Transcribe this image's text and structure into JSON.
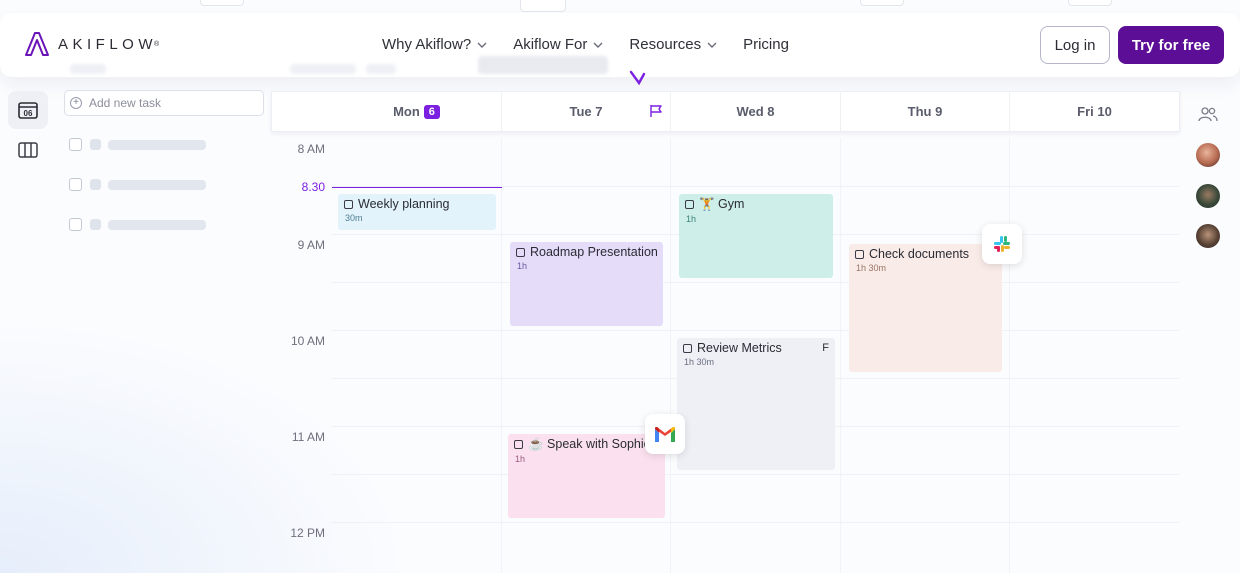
{
  "brand": {
    "name": "AKIFLOW",
    "reg": "®",
    "color": "#5d0e97"
  },
  "nav": {
    "menu": [
      {
        "label": "Why Akiflow?",
        "dropdown": true
      },
      {
        "label": "Akiflow For",
        "dropdown": true
      },
      {
        "label": "Resources",
        "dropdown": true
      },
      {
        "label": "Pricing",
        "dropdown": false
      }
    ],
    "login": "Log in",
    "cta": "Try for free"
  },
  "sidebar": {
    "calendar_icon_text": "06",
    "add_task_placeholder": "Add new task"
  },
  "calendar": {
    "days": [
      {
        "label": "Mon",
        "badge": "6"
      },
      {
        "label": "Tue 7"
      },
      {
        "label": "Wed 8"
      },
      {
        "label": "Thu 9"
      },
      {
        "label": "Fri 10"
      }
    ],
    "times": [
      "8 AM",
      "9 AM",
      "10 AM",
      "11 AM",
      "12 PM"
    ],
    "now": "8.30",
    "accent": "#7b1fe0",
    "events": [
      {
        "title": "Weekly planning",
        "duration": "30m",
        "color": "#e2f3fb"
      },
      {
        "title": "Roadmap Presentation",
        "duration": "1h",
        "color": "#e5dcfa"
      },
      {
        "title": "🏋 Gym",
        "duration": "1h",
        "color": "#cdeee9"
      },
      {
        "title": "Review Metrics",
        "duration": "1h 30m",
        "color": "#eef0f6",
        "overflow": "F"
      },
      {
        "title": "Check documents",
        "duration": "1h 30m",
        "color": "#f9ece8"
      },
      {
        "title": "☕ Speak with Sophie",
        "duration": "1h",
        "color": "#fbe1ef"
      }
    ]
  }
}
